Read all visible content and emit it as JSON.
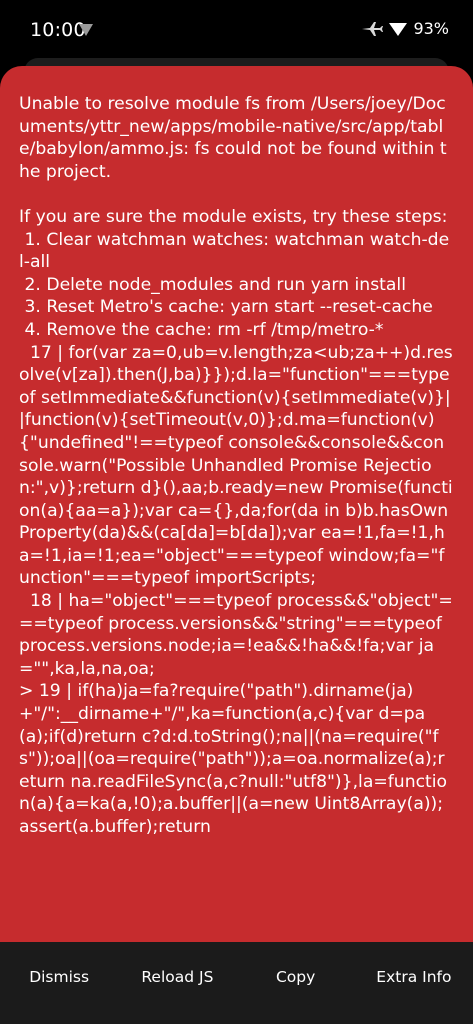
{
  "status_bar": {
    "time": "10:00",
    "battery_percent": "93%",
    "icons": [
      "wifi-icon",
      "airplane-icon",
      "signal-icon"
    ]
  },
  "error": {
    "message": "Unable to resolve module fs from /Users/joey/Documents/yttr_new/apps/mobile-native/src/app/table/babylon/ammo.js: fs could not be found within the project.\n\nIf you are sure the module exists, try these steps:\n 1. Clear watchman watches: watchman watch-del-all\n 2. Delete node_modules and run yarn install\n 3. Reset Metro's cache: yarn start --reset-cache\n 4. Remove the cache: rm -rf /tmp/metro-*\n  17 | for(var za=0,ub=v.length;za<ub;za++)d.resolve(v[za]).then(J,ba)}});d.la=\"function\"===typeof setImmediate&&function(v){setImmediate(v)}||function(v){setTimeout(v,0)};d.ma=function(v){\"undefined\"!==typeof console&&console&&console.warn(\"Possible Unhandled Promise Rejection:\",v)};return d}(),aa;b.ready=new Promise(function(a){aa=a});var ca={},da;for(da in b)b.hasOwnProperty(da)&&(ca[da]=b[da]);var ea=!1,fa=!1,ha=!1,ia=!1;ea=\"object\"===typeof window;fa=\"function\"===typeof importScripts;\n  18 | ha=\"object\"===typeof process&&\"object\"===typeof process.versions&&\"string\"===typeof process.versions.node;ia=!ea&&!ha&&!fa;var ja=\"\",ka,la,na,oa;\n> 19 | if(ha)ja=fa?require(\"path\").dirname(ja)+\"/\":__dirname+\"/\",ka=function(a,c){var d=pa(a);if(d)return c?d:d.toString();na||(na=require(\"fs\"));oa||(oa=require(\"path\"));a=oa.normalize(a);return na.readFileSync(a,c?null:\"utf8\")},la=function(a){a=ka(a,!0);a.buffer||(a=new Uint8Array(a));assert(a.buffer);return"
  },
  "actions": {
    "dismiss": "Dismiss",
    "reload": "Reload JS",
    "copy": "Copy",
    "extra_info": "Extra Info"
  },
  "colors": {
    "error_background": "#c62c2e",
    "bottom_bar": "#1b1b1b",
    "status_bar": "#000000"
  }
}
